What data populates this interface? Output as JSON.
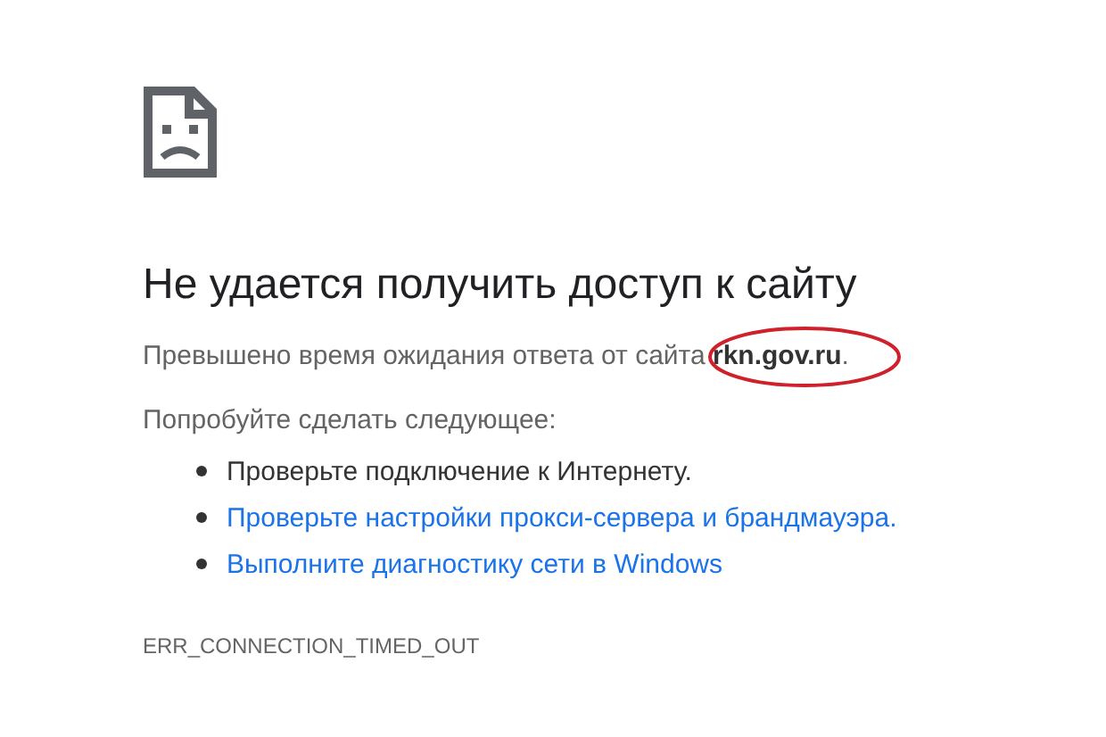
{
  "heading": "Не удается получить доступ к сайту",
  "message": "Превышено время ожидания ответа от сайта **rkn.gov.ru**.",
  "suggestions_title": "Попробуйте сделать следующее:",
  "suggestions": [
    {
      "kind": "text",
      "label": "Проверьте подключение к Интернету."
    },
    {
      "kind": "link",
      "label": "Проверьте настройки прокси-сервера и брандмауэра."
    },
    {
      "kind": "link",
      "label": "Выполните диагностику сети в Windows"
    }
  ],
  "error_code": "ERR_CONNECTION_TIMED_OUT"
}
